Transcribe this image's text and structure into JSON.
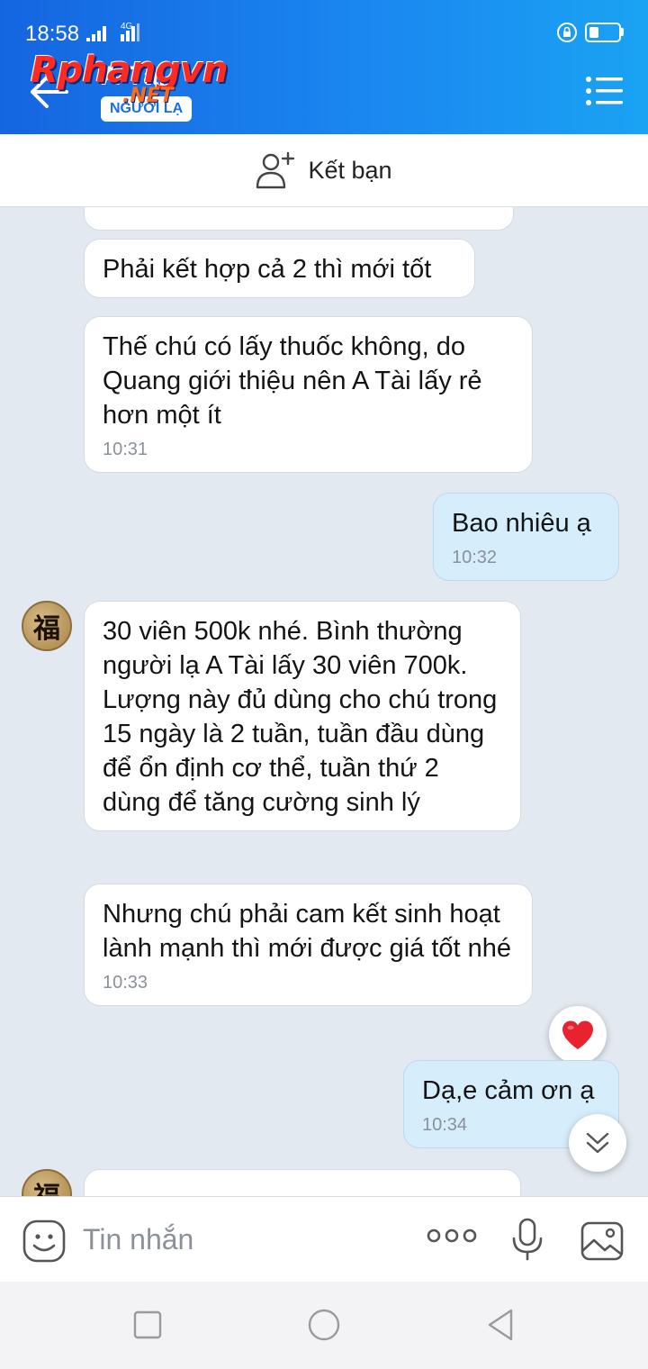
{
  "status_bar": {
    "time": "18:58",
    "network": "4G"
  },
  "header": {
    "contact_name": "A Tài",
    "badge": "NGƯỜI LẠ",
    "watermark_main": "Rphangvn",
    "watermark_suffix": ".NET",
    "icons": {
      "back": "arrow-left-icon",
      "menu": "hamburger-menu-icon"
    }
  },
  "add_friend": {
    "label": "Kết bạn",
    "icon": "add-person-icon"
  },
  "messages": [
    {
      "sender": "them",
      "text": "",
      "time": ""
    },
    {
      "sender": "them",
      "text": "Phải kết hợp cả 2 thì mới tốt",
      "time": ""
    },
    {
      "sender": "them",
      "text": "Thế chú có lấy thuốc không, do Quang giới thiệu nên A Tài lấy rẻ hơn một ít",
      "time": "10:31"
    },
    {
      "sender": "me",
      "text": "Bao nhiêu ạ",
      "time": "10:32"
    },
    {
      "sender": "them",
      "text": "30 viên 500k nhé. Bình thường người lạ A Tài lấy 30 viên 700k. Lượng này đủ dùng cho chú trong 15 ngày là 2 tuần, tuần đầu dùng để ổn định cơ thể, tuần thứ 2 dùng để tăng cường sinh lý",
      "time": ""
    },
    {
      "sender": "them",
      "text": "Nhưng chú phải cam kết sinh hoạt lành mạnh thì mới được giá tốt nhé",
      "time": "10:33"
    },
    {
      "sender": "me",
      "text": "Dạ,e cảm ơn ạ",
      "time": "10:34"
    }
  ],
  "avatar_glyph": "福",
  "reaction_icon": "heart-icon",
  "input_bar": {
    "placeholder": "Tin nhắn",
    "icons": [
      "emoji-icon",
      "more-dots-icon",
      "microphone-icon",
      "image-icon"
    ]
  },
  "nav_bar": {
    "icons": [
      "recent-apps-icon",
      "home-icon",
      "back-triangle-icon"
    ]
  },
  "colors": {
    "header_start": "#1565e0",
    "header_end": "#1aa3f3",
    "chat_bg": "#e2e9f1",
    "my_bubble": "#d6edfb",
    "their_bubble": "#ffffff",
    "heart": "#e8232f"
  }
}
